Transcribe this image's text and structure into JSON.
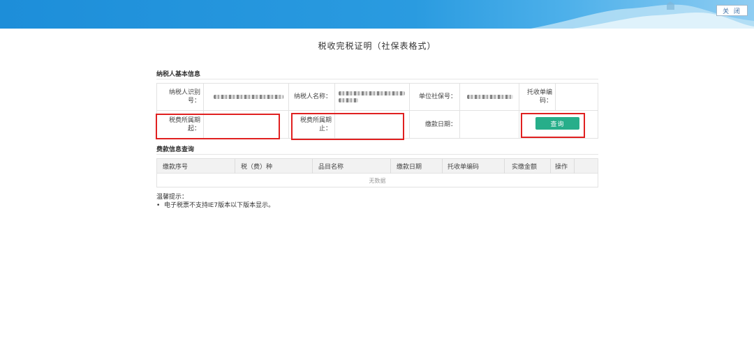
{
  "header": {
    "close_label": "关 闭",
    "colors": {
      "banner": "#1d8ed9",
      "accent": "#27ae8a",
      "highlight": "#e02020"
    }
  },
  "page": {
    "title": "税收完税证明（社保表格式）"
  },
  "taxpayer_section": {
    "title": "纳税人基本信息",
    "taxpayer_id_label": "纳税人识别号：",
    "taxpayer_name_label": "纳税人名称：",
    "social_security_no_label": "单位社保号：",
    "collection_no_label": "托收单编码：",
    "period_start_label": "税费所属期起：",
    "period_end_label": "税费所属期止：",
    "payment_date_label": "缴款日期：",
    "query_button": "查询"
  },
  "fee_section": {
    "title": "费款信息查询",
    "columns": [
      "缴款序号",
      "税（费）种",
      "品目名称",
      "缴款日期",
      "托收单编码",
      "实缴金额",
      "操作"
    ],
    "empty_text": "无数据"
  },
  "tips": {
    "title": "温馨提示：",
    "items": [
      "电子税票不支持IE7版本以下版本显示。"
    ]
  }
}
